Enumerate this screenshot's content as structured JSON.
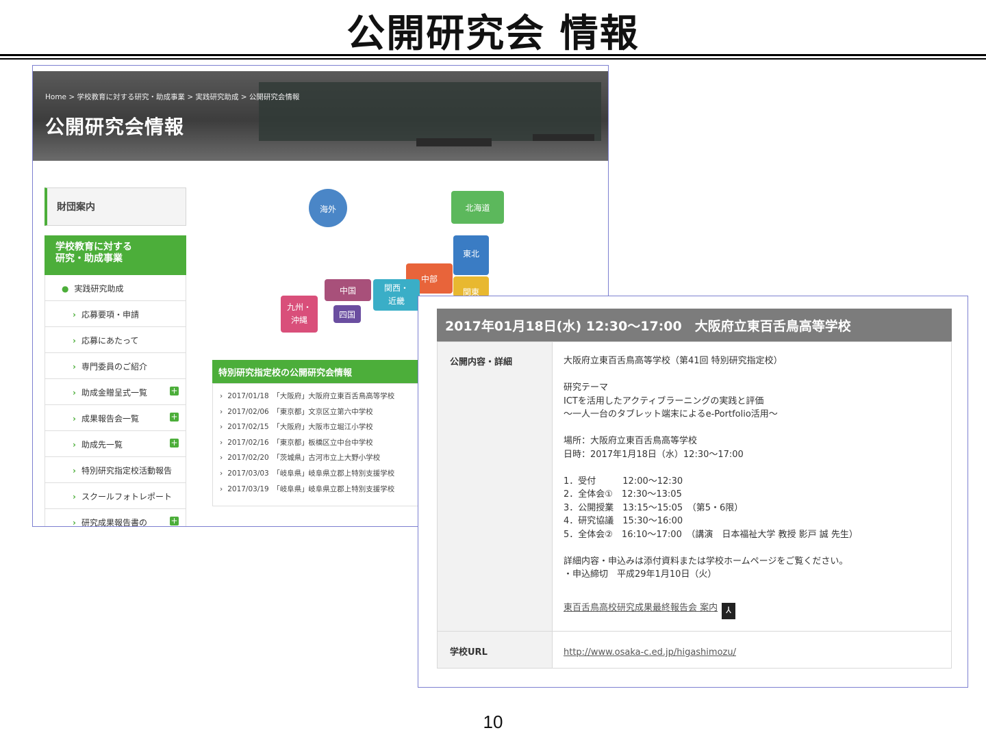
{
  "slide": {
    "title": "公開研究会 情報",
    "page_number": "10"
  },
  "site": {
    "breadcrumb": "Home > 学校教育に対する研究・助成事業 > 実践研究助成 > 公開研究会情報",
    "hero_title": "公開研究会情報",
    "sidebar": {
      "top_item": "財団案内",
      "section_line1": "学校教育に対する",
      "section_line2": "研究・助成事業",
      "items": [
        {
          "label": "実践研究助成",
          "level": 1,
          "marker": "●",
          "plus": false
        },
        {
          "label": "応募要項・申請",
          "level": 2,
          "marker": "›",
          "plus": false
        },
        {
          "label": "応募にあたって",
          "level": 2,
          "marker": "›",
          "plus": false
        },
        {
          "label": "専門委員のご紹介",
          "level": 2,
          "marker": "›",
          "plus": false
        },
        {
          "label": "助成金贈呈式一覧",
          "level": 2,
          "marker": "›",
          "plus": true
        },
        {
          "label": "成果報告会一覧",
          "level": 2,
          "marker": "›",
          "plus": true
        },
        {
          "label": "助成先一覧",
          "level": 2,
          "marker": "›",
          "plus": true
        },
        {
          "label": "特別研究指定校活動報告",
          "level": 2,
          "marker": "›",
          "plus": false
        },
        {
          "label": "スクールフォトレポート",
          "level": 2,
          "marker": "›",
          "plus": false
        },
        {
          "label": "研究成果報告書の",
          "level": 2,
          "marker": "›",
          "plus": true
        }
      ]
    },
    "map_regions": {
      "overseas": {
        "label": "海外",
        "color": "#4a86c7"
      },
      "hokkaido": {
        "label": "北海道",
        "color": "#5cb85c"
      },
      "tohoku": {
        "label": "東北",
        "color": "#3a7cc4"
      },
      "chubu": {
        "label": "中部",
        "color": "#e8643a"
      },
      "kanto": {
        "label": "関東",
        "color": "#e8b830"
      },
      "kansai_1": {
        "label": "関西・",
        "color": "#3aaec7"
      },
      "kansai_2": {
        "label": "近畿",
        "color": "#3aaec7"
      },
      "chugoku": {
        "label": "中国",
        "color": "#a8507a"
      },
      "shikoku": {
        "label": "四国",
        "color": "#6a4ea0"
      },
      "kyushu_1": {
        "label": "九州・",
        "color": "#d94f7a"
      },
      "kyushu_2": {
        "label": "沖縄",
        "color": "#d94f7a"
      }
    },
    "news": {
      "header": "特別研究指定校の公開研究会情報",
      "rows": [
        {
          "date": "2017/01/18",
          "pref": "「大阪府」",
          "school": "大阪府立東百舌鳥高等学校"
        },
        {
          "date": "2017/02/06",
          "pref": "「東京都」",
          "school": "文京区立第六中学校"
        },
        {
          "date": "2017/02/15",
          "pref": "「大阪府」",
          "school": "大阪市立堀江小学校"
        },
        {
          "date": "2017/02/16",
          "pref": "「東京都」",
          "school": "板橋区立中台中学校"
        },
        {
          "date": "2017/02/20",
          "pref": "「茨城県」",
          "school": "古河市立上大野小学校"
        },
        {
          "date": "2017/03/03",
          "pref": "「岐阜県」",
          "school": "岐阜県立郡上特別支援学校"
        },
        {
          "date": "2017/03/19",
          "pref": "「岐阜県」",
          "school": "岐阜県立郡上特別支援学校"
        }
      ]
    }
  },
  "event": {
    "header": "2017年01月18日(水) 12:30～17:00　大阪府立東百舌鳥高等学校",
    "detail_label": "公開内容・詳細",
    "url_label": "学校URL",
    "intro": "大阪府立東百舌鳥高等学校（第41回 特別研究指定校）",
    "theme_label": "研究テーマ",
    "theme_line1": "ICTを活用したアクティブラーニングの実践と評価",
    "theme_line2": "～一人一台のタブレット端末によるe-Portfolio活用～",
    "place": "場所：大阪府立東百舌鳥高等学校",
    "datetime": "日時：2017年1月18日（水）12:30～17:00",
    "schedule": [
      "1．受付　　　12:00～12:30",
      "2．全体会①　12:30～13:05",
      "3．公開授業　13:15～15:05　（第5・6限）",
      "4．研究協議　15:30～16:00",
      "5．全体会②　16:10～17:00　（講演　日本福祉大学 教授 影戸 誠 先生）"
    ],
    "note1": "詳細内容・申込みは添付資料または学校ホームページをご覧ください。",
    "note2": "・申込締切　平成29年1月10日（火）",
    "pdf_link": "東百舌鳥高校研究成果最終報告会 案内",
    "pdf_icon": "pdf-icon",
    "pdf_glyph": "⅄",
    "url": "http://www.osaka-c.ed.jp/higashimozu/"
  }
}
